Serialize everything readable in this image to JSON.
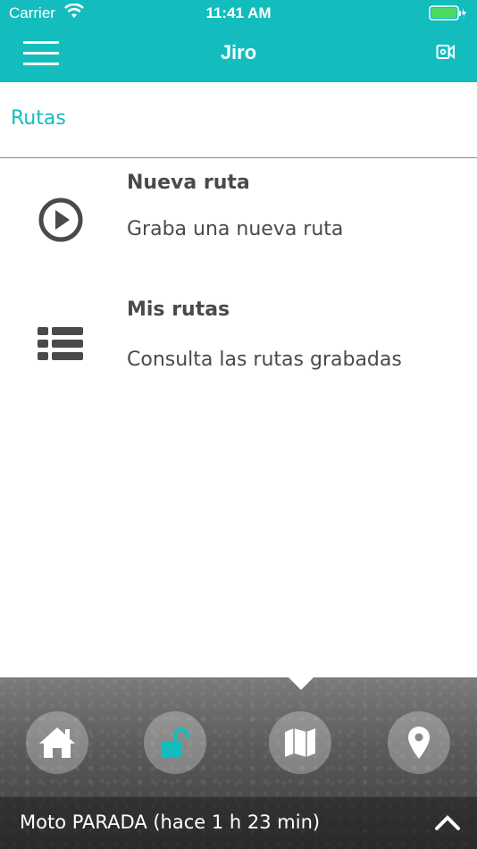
{
  "status_bar": {
    "carrier": "Carrier",
    "time": "11:41 AM",
    "battery_color": "#4cd964"
  },
  "nav": {
    "title": "Jiro",
    "menu_icon": "hamburger-icon",
    "right_icon": "video-camera-icon"
  },
  "section": {
    "title": "Rutas"
  },
  "items": [
    {
      "title": "Nueva ruta",
      "description": "Graba una nueva ruta",
      "icon": "play-circle-icon"
    },
    {
      "title": "Mis rutas",
      "description": "Consulta las rutas grabadas",
      "icon": "list-icon"
    }
  ],
  "tabs": [
    {
      "name": "home",
      "icon": "home-icon"
    },
    {
      "name": "unlock",
      "icon": "unlock-icon",
      "color": "#14bdbd"
    },
    {
      "name": "map",
      "icon": "map-icon"
    },
    {
      "name": "location",
      "icon": "location-pin-icon"
    }
  ],
  "footer": {
    "status_text": "Moto PARADA (hace 1 h 23 min)",
    "expand_icon": "chevron-up-icon"
  },
  "colors": {
    "accent": "#14bdbd",
    "text": "#4a4a4a"
  }
}
